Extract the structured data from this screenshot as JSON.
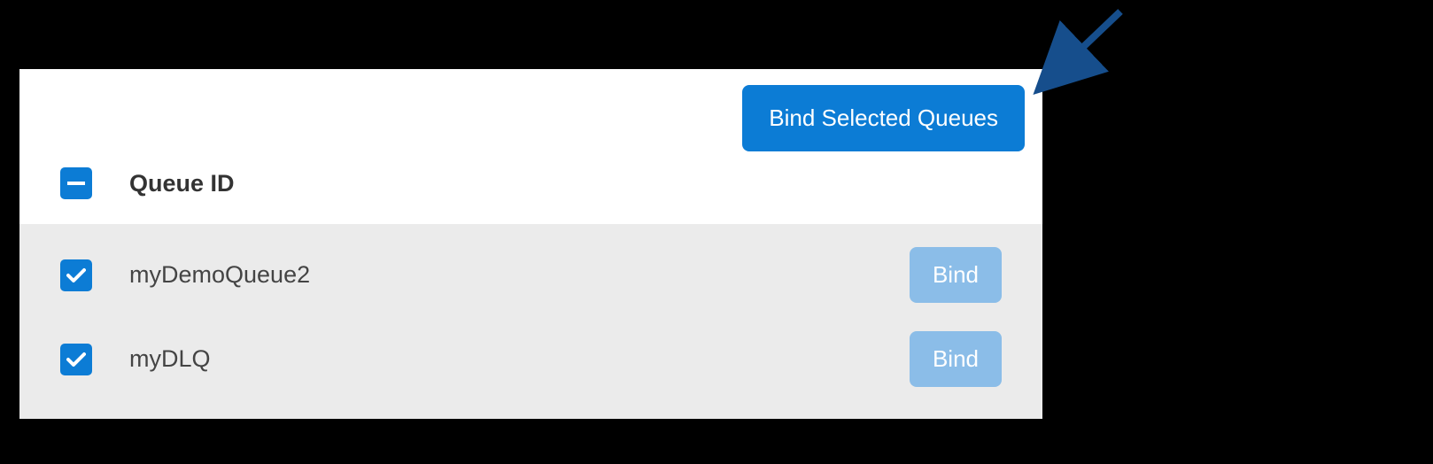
{
  "toolbar": {
    "bind_selected_label": "Bind Selected Queues"
  },
  "table": {
    "header": {
      "column_label": "Queue ID",
      "all_state": "indeterminate"
    },
    "rows": [
      {
        "id": "myDemoQueue2",
        "checked": true,
        "bind_label": "Bind"
      },
      {
        "id": "myDLQ",
        "checked": true,
        "bind_label": "Bind"
      }
    ]
  },
  "colors": {
    "primary": "#0c7cd5",
    "bind_button": "#8bbde8",
    "row_bg": "#ebebeb",
    "annotation_arrow": "#164e8c"
  }
}
